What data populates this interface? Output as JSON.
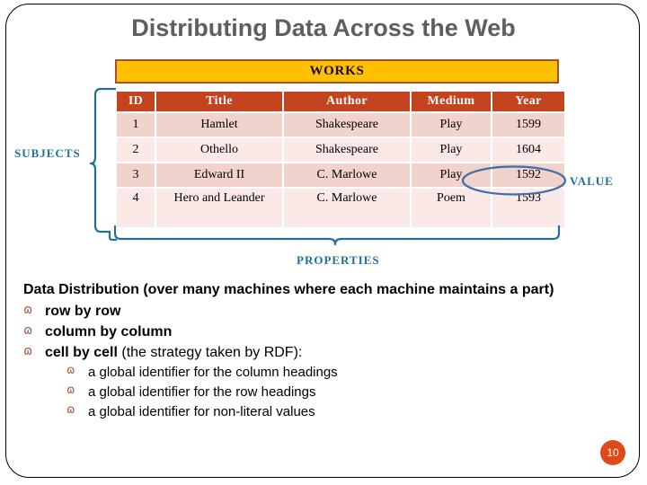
{
  "slide": {
    "title": "Distributing Data Across the Web",
    "page_number": "10",
    "accent_colors": {
      "title_grey": "#5e5e5e",
      "works_bar_fill": "#ffc000",
      "works_bar_border": "#a0522d",
      "table_header_fill": "#c3441f",
      "row_dark": "#f2d2cd",
      "row_light": "#fae9e6",
      "annotation_blue": "#1f7099",
      "bullet_brown": "#9c5b3a",
      "badge_orange": "#e04a1a"
    }
  },
  "table": {
    "caption": "WORKS",
    "columns": [
      "ID",
      "Title",
      "Author",
      "Medium",
      "Year"
    ],
    "rows": [
      {
        "id": "1",
        "title": "Hamlet",
        "author": "Shakespeare",
        "medium": "Play",
        "year": "1599"
      },
      {
        "id": "2",
        "title": "Othello",
        "author": "Shakespeare",
        "medium": "Play",
        "year": "1604"
      },
      {
        "id": "3",
        "title": "Edward II",
        "author": "C. Marlowe",
        "medium": "Play",
        "year": "1592"
      },
      {
        "id": "4",
        "title": "Hero and Leander",
        "author": "C. Marlowe",
        "medium": "Poem",
        "year": "1593"
      }
    ]
  },
  "annotations": {
    "subjects": "SUBJECTS",
    "value": "VALUE",
    "properties": "PROPERTIES",
    "highlighted_cell": "1592"
  },
  "body": {
    "heading": "Data Distribution (over many machines where each machine maintains a part)",
    "bullet_glyph": "ɷ",
    "items": [
      {
        "bold": "row by row",
        "rest": ""
      },
      {
        "bold": "column by column",
        "rest": ""
      },
      {
        "bold": "cell by cell",
        "rest": " (the strategy taken by RDF):"
      }
    ],
    "subitems": [
      "a global identifier for the column headings",
      "a global identifier for the row headings",
      "a global identifier for non-literal values"
    ]
  }
}
